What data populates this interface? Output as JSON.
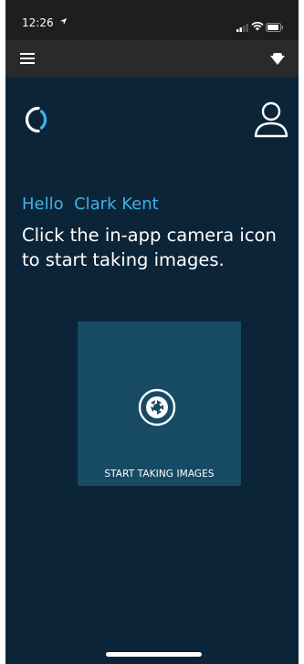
{
  "status_bar": {
    "time": "12:26",
    "location_icon": "location-arrow",
    "signal_icon": "signal-bars",
    "wifi_icon": "wifi",
    "battery_icon": "battery"
  },
  "toolbar": {
    "menu_icon": "hamburger-menu",
    "dropdown_icon": "dropdown-triangle"
  },
  "header": {
    "logo_icon": "app-logo-ring",
    "profile_icon": "user-profile"
  },
  "main": {
    "greeting": "Hello  Clark Kent",
    "instructions": "Click the in-app camera icon to start taking images."
  },
  "camera_card": {
    "icon": "camera-shutter",
    "label": "START TAKING IMAGES"
  },
  "colors": {
    "background": "#0c2438",
    "accent": "#3ab4e8",
    "card": "#174a63",
    "status_bar": "#1e1e1e",
    "toolbar": "#2a2a2a"
  }
}
